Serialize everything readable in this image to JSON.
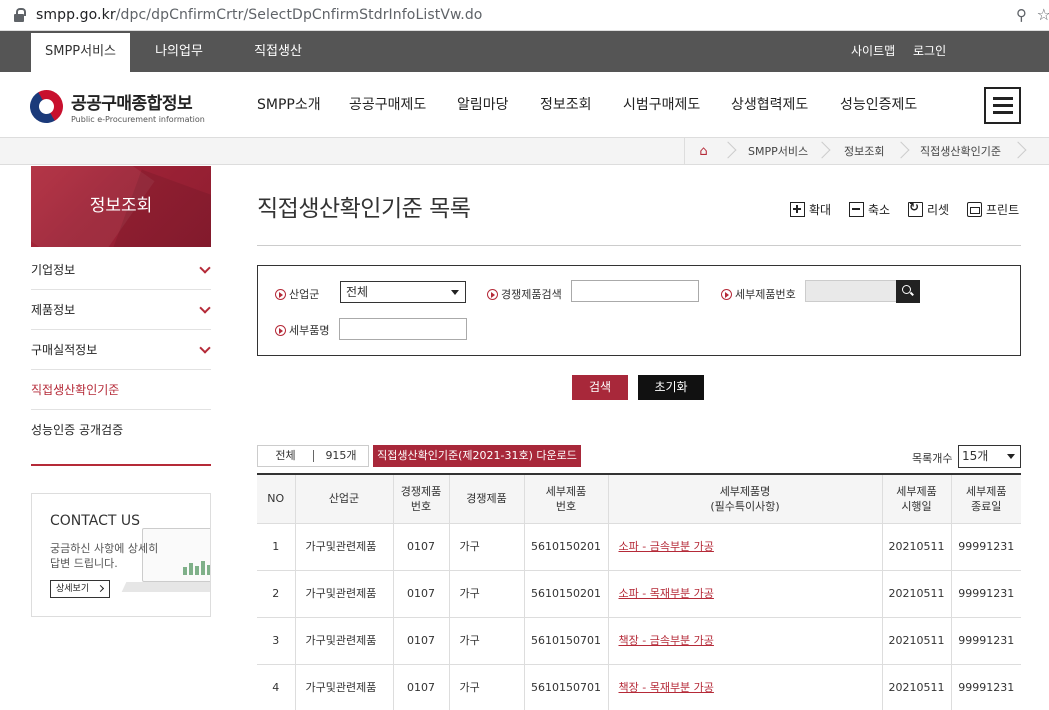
{
  "browser": {
    "url_host": "smpp.go.kr",
    "url_path": "/dpc/dpCnfirmCrtr/SelectDpCnfirmStdrInfoListVw.do"
  },
  "topbar": {
    "tabs": [
      "SMPP서비스",
      "나의업무",
      "직접생산"
    ],
    "utils": [
      "사이트맵",
      "로그인"
    ]
  },
  "header": {
    "logo_ko": "공공구매종합정보",
    "logo_en": "Public e-Procurement information",
    "gnb": [
      "SMPP소개",
      "공공구매제도",
      "알림마당",
      "정보조회",
      "시범구매제도",
      "상생협력제도",
      "성능인증제도"
    ]
  },
  "breadcrumb": [
    "SMPP서비스",
    "정보조회",
    "직접생산확인기준"
  ],
  "sidebar": {
    "title": "정보조회",
    "items": [
      {
        "label": "기업정보"
      },
      {
        "label": "제품정보"
      },
      {
        "label": "구매실적정보"
      },
      {
        "label": "직접생산확인기준"
      },
      {
        "label": "성능인증 공개검증"
      }
    ],
    "contact": {
      "title": "CONTACT US",
      "desc": "궁금하신 사항에 상세히 답변 드립니다.",
      "more": "상세보기"
    }
  },
  "main": {
    "title": "직접생산확인기준 목록",
    "tools": [
      "확대",
      "축소",
      "리셋",
      "프린트"
    ],
    "search": {
      "industry_label": "산업군",
      "industry_value": "전체",
      "competitive_label": "경쟁제품검색",
      "competitive_value": "",
      "detail_no_label": "세부제품번호",
      "detail_no_value": "",
      "detail_name_label": "세부품명",
      "detail_name_value": ""
    },
    "search_button": "검색",
    "reset_button": "초기화",
    "total_label": "전체",
    "total_count": "915개",
    "download_button": "직접생산확인기준(제2021-31호) 다운로드",
    "per_page_label": "목록개수",
    "per_page_value": "15개",
    "columns": [
      "NO",
      "산업군",
      "경쟁제품\n번호",
      "경쟁제품",
      "세부제품\n번호",
      "세부제품명\n(필수특이사항)",
      "세부제품\n시행일",
      "세부제품\n종료일"
    ],
    "rows": [
      {
        "no": "1",
        "industry": "가구및관련제품",
        "comp_no": "0107",
        "comp": "가구",
        "detail_no": "5610150201",
        "detail_name": "소파 - 금속부분 가공",
        "start": "20210511",
        "end": "99991231"
      },
      {
        "no": "2",
        "industry": "가구및관련제품",
        "comp_no": "0107",
        "comp": "가구",
        "detail_no": "5610150201",
        "detail_name": "소파 - 목재부분 가공",
        "start": "20210511",
        "end": "99991231"
      },
      {
        "no": "3",
        "industry": "가구및관련제품",
        "comp_no": "0107",
        "comp": "가구",
        "detail_no": "5610150701",
        "detail_name": "책장 - 금속부분 가공",
        "start": "20210511",
        "end": "99991231"
      },
      {
        "no": "4",
        "industry": "가구및관련제품",
        "comp_no": "0107",
        "comp": "가구",
        "detail_no": "5610150701",
        "detail_name": "책장 - 목재부분 가공",
        "start": "20210511",
        "end": "99991231"
      }
    ]
  },
  "colors": {
    "accent": "#a8283a",
    "topbar": "#555555"
  }
}
